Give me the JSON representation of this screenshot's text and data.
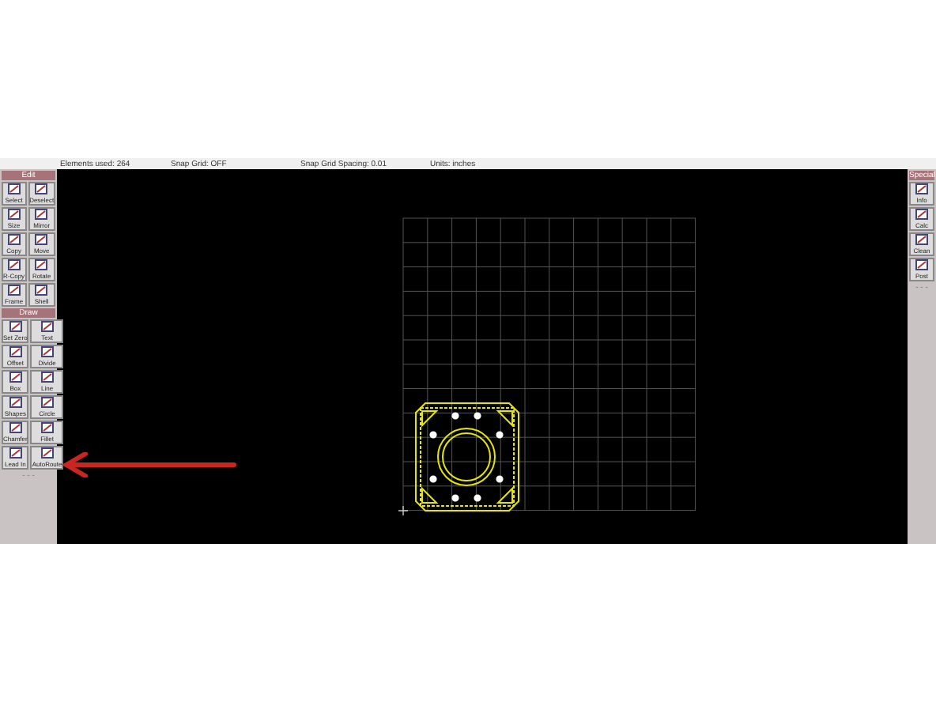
{
  "status_bar": [
    "Elements used: 264",
    "Snap Grid: OFF",
    "Snap Grid Spacing: 0.01",
    "Units: inches"
  ],
  "left_toolbar": {
    "sections": [
      {
        "title": "Edit",
        "tools": [
          "Select",
          "Deselect",
          "Size",
          "Mirror",
          "Copy",
          "Move",
          "R-Copy",
          "Rotate",
          "Frame",
          "Shell"
        ]
      },
      {
        "title": "Draw",
        "tools": [
          "Set Zero",
          "Text",
          "Offset",
          "Divide",
          "Box",
          "Line",
          "Shapes",
          "Circle",
          "Chamfer",
          "Fillet",
          "Lead In",
          "AutoRoute"
        ]
      }
    ],
    "more": "- - -"
  },
  "right_toolbar": {
    "title": "Special",
    "tools": [
      "Info",
      "Calc",
      "Clean",
      "Post"
    ],
    "more": "- - -"
  }
}
